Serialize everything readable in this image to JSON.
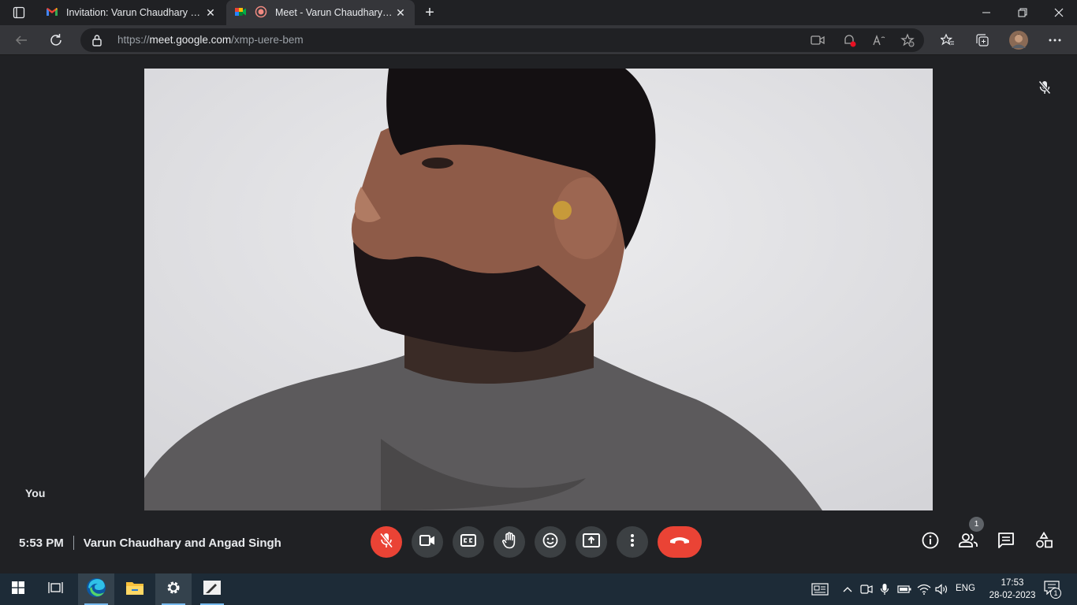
{
  "browser": {
    "tabs": [
      {
        "title": "Invitation: Varun Chaudhary and",
        "favicon": "gmail-icon",
        "active": false
      },
      {
        "title": "Meet - Varun Chaudhary and",
        "favicon": "google-meet-icon",
        "active": true,
        "recording": true
      }
    ],
    "address_bar": {
      "scheme": "https://",
      "host": "meet.google.com",
      "path": "/xmp-uere-bem"
    }
  },
  "meet": {
    "self_label": "You",
    "time": "5:53 PM",
    "meeting_title": "Varun Chaudhary and Angad Singh",
    "participants_count": "1",
    "controls": [
      "microphone-off",
      "camera",
      "captions",
      "raise-hand",
      "reactions",
      "present",
      "more-options",
      "leave-call"
    ],
    "side_controls": [
      "meeting-details",
      "people",
      "chat",
      "activities"
    ],
    "colors": {
      "background": "#202124",
      "control": "#3c4043",
      "danger": "#ea4335"
    }
  },
  "taskbar": {
    "apps": [
      "windows-start",
      "task-view",
      "edge",
      "file-explorer",
      "settings",
      "snip-sketch"
    ],
    "language": "ENG",
    "time": "17:53",
    "date": "28-02-2023",
    "notifications": "1"
  }
}
